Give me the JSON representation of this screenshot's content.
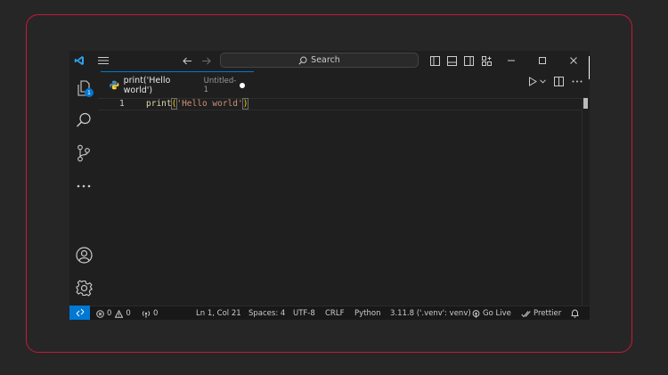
{
  "window": {
    "search_placeholder": "Search",
    "title_icons": [
      "vscode-logo",
      "menu",
      "back-arrow",
      "forward-arrow",
      "layout-sidebar-left",
      "layout-panel",
      "layout-sidebar-right",
      "customize-layout",
      "minimize",
      "maximize",
      "close"
    ]
  },
  "activity_bar": {
    "explorer_badge": "1",
    "items": [
      "explorer",
      "search",
      "source-control",
      "more",
      "accounts",
      "manage"
    ]
  },
  "tab": {
    "title": "print('Hello world')",
    "description": "Untitled-1",
    "dirty": true
  },
  "editor": {
    "line_number": "1",
    "code": {
      "fn": "print",
      "open": "(",
      "str": "'Hello world'",
      "close": ")"
    }
  },
  "status_bar": {
    "errors": "0",
    "warnings": "0",
    "ports": "0",
    "position": "Ln 1, Col 21",
    "spaces": "Spaces: 4",
    "encoding": "UTF-8",
    "eol": "CRLF",
    "language": "Python",
    "interpreter": "3.11.8 ('.venv': venv)",
    "go_live": "Go Live",
    "prettier": "Prettier"
  },
  "colors": {
    "frame_border": "#c41a3c",
    "accent": "#0078d4",
    "background": "#262626",
    "window": "#1f1f1f"
  }
}
